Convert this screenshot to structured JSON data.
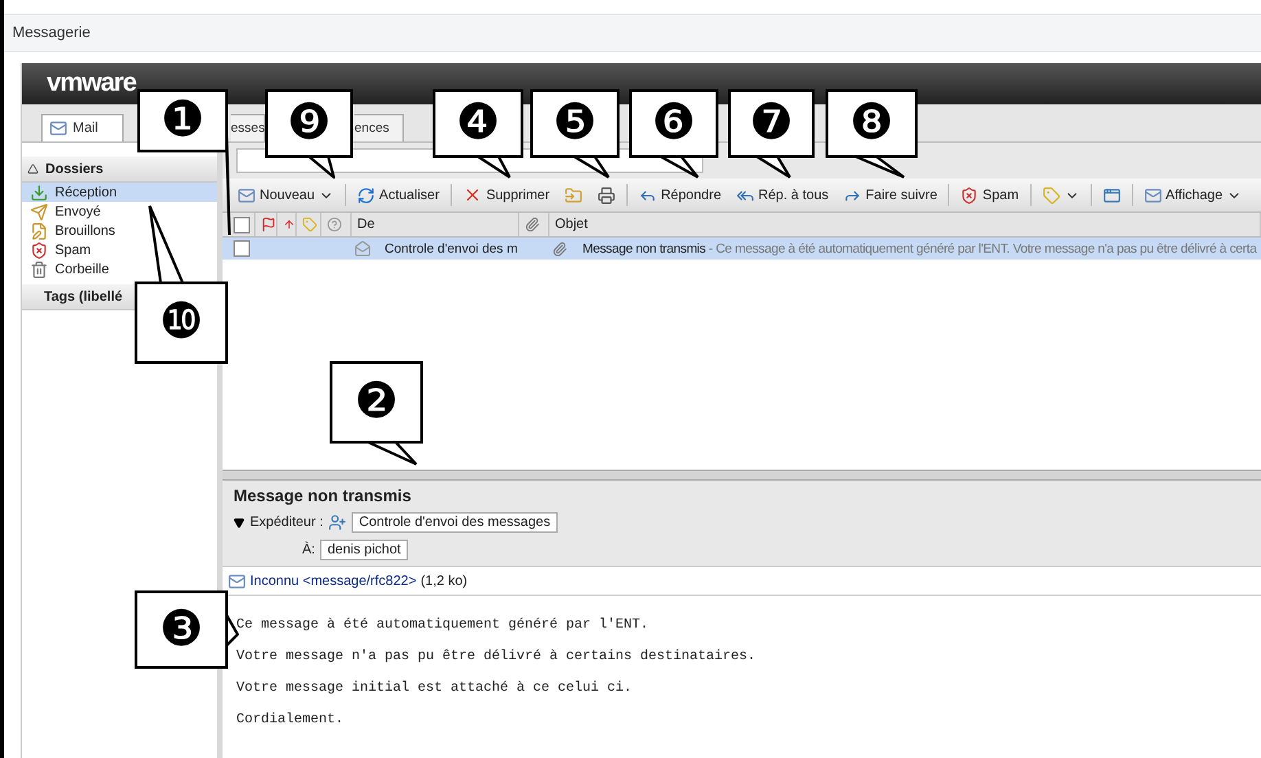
{
  "page_title": "Messagerie",
  "logo": {
    "brand": "vmware"
  },
  "tabs": [
    {
      "label": "Mail",
      "selected": true
    },
    {
      "label": "esses",
      "selected": false
    },
    {
      "label": "ences",
      "selected": false
    }
  ],
  "sidebar": {
    "header": "Dossiers",
    "expanded": true,
    "items": [
      {
        "label": "Réception",
        "kind": "inbox",
        "selected": true
      },
      {
        "label": "Envoyé",
        "kind": "sent",
        "selected": false
      },
      {
        "label": "Brouillons",
        "kind": "drafts",
        "selected": false
      },
      {
        "label": "Spam",
        "kind": "spam",
        "selected": false
      },
      {
        "label": "Corbeille",
        "kind": "trash",
        "selected": false
      }
    ],
    "tags_header": "Tags (libellé"
  },
  "toolbar": [
    {
      "kind": "new",
      "label": "Nouveau",
      "menu": true
    },
    {
      "kind": "refresh",
      "label": "Actualiser"
    },
    {
      "kind": "delete",
      "label": "Supprimer"
    },
    {
      "kind": "move"
    },
    {
      "kind": "print"
    },
    {
      "kind": "reply",
      "label": "Répondre"
    },
    {
      "kind": "reply_all",
      "label": "Rép. à tous"
    },
    {
      "kind": "forward",
      "label": "Faire suivre"
    },
    {
      "kind": "spam",
      "label": "Spam"
    },
    {
      "kind": "tag",
      "menu": true
    },
    {
      "kind": "window"
    },
    {
      "kind": "view",
      "label": "Affichage",
      "menu": true
    }
  ],
  "columns": {
    "select_all_checked": false,
    "from": "De",
    "subject": "Objet"
  },
  "messages": [
    {
      "checked": false,
      "selected": true,
      "from": "Controle d'envoi des m",
      "subject": "Message non transmis",
      "excerpt": " - Ce message à été automatiquement généré par l'ENT. Votre message n'a pas pu être délivré à certa",
      "attachment": true
    }
  ],
  "reading_pane": {
    "subject": "Message non transmis",
    "sender_label": "Expéditeur :",
    "sender": "Controle d'envoi des messages",
    "to_label": "À:",
    "to": "denis pichot",
    "attachment": "Inconnu <message/rfc822>",
    "attachment_size": "(1,2 ko)",
    "body": [
      "Ce message à été automatiquement généré par l'ENT.",
      "Votre message n'a pas pu être délivré à certains destinataires.",
      "Votre message initial est attaché à ce celui ci.",
      "Cordialement."
    ]
  },
  "callouts": [
    {
      "number": "❶"
    },
    {
      "number": "❾"
    },
    {
      "number": "❹"
    },
    {
      "number": "❺"
    },
    {
      "number": "❻"
    },
    {
      "number": "❼"
    },
    {
      "number": "❽"
    },
    {
      "number": "❿"
    },
    {
      "number": "❷"
    },
    {
      "number": "❸"
    }
  ]
}
